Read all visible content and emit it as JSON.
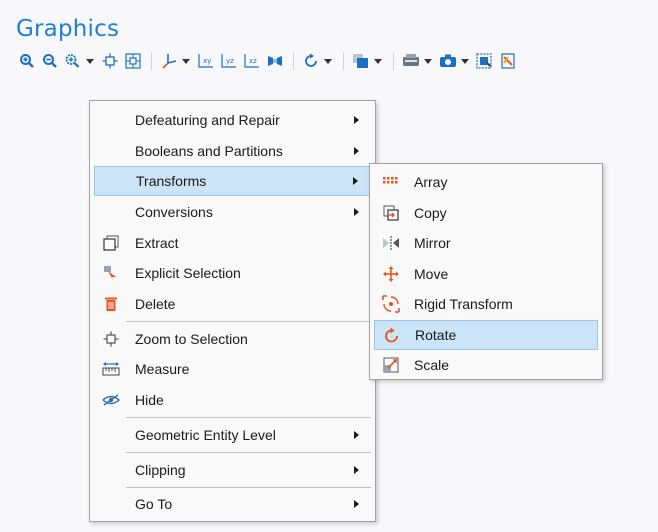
{
  "panel": {
    "title": "Graphics"
  },
  "toolbar": {
    "buttons": [
      {
        "icon": "zoom-in-icon"
      },
      {
        "icon": "zoom-out-icon"
      },
      {
        "icon": "zoom-box-icon"
      },
      {
        "icon": "zoom-selection-icon"
      },
      {
        "icon": "zoom-extents-icon"
      },
      {
        "icon": "axis-orientation-icon"
      },
      {
        "icon": "xy-view-icon"
      },
      {
        "icon": "yz-view-icon"
      },
      {
        "icon": "xz-view-icon"
      },
      {
        "icon": "perspective-icon"
      },
      {
        "icon": "rotate-view-icon"
      },
      {
        "icon": "transparency-icon"
      },
      {
        "icon": "render-icon"
      },
      {
        "icon": "screenshot-icon"
      },
      {
        "icon": "select-box-icon"
      },
      {
        "icon": "hide-icon"
      }
    ]
  },
  "context_menu": {
    "items": [
      {
        "label": "Defeaturing and Repair",
        "submenu": true
      },
      {
        "label": "Booleans and Partitions",
        "submenu": true
      },
      {
        "label": "Transforms",
        "submenu": true,
        "highlighted": true
      },
      {
        "label": "Conversions",
        "submenu": true
      },
      {
        "label": "Extract",
        "icon": "extract-icon"
      },
      {
        "label": "Explicit Selection",
        "icon": "explicit-selection-icon"
      },
      {
        "label": "Delete",
        "icon": "delete-icon"
      },
      {
        "label": "Zoom to Selection",
        "icon": "zoom-selection-icon"
      },
      {
        "label": "Measure",
        "icon": "measure-icon"
      },
      {
        "label": "Hide",
        "icon": "hide-icon"
      },
      {
        "label": "Geometric Entity Level",
        "submenu": true
      },
      {
        "label": "Clipping",
        "submenu": true
      },
      {
        "label": "Go To",
        "submenu": true
      }
    ]
  },
  "transforms_submenu": {
    "items": [
      {
        "label": "Array",
        "icon": "array-icon"
      },
      {
        "label": "Copy",
        "icon": "copy-icon"
      },
      {
        "label": "Mirror",
        "icon": "mirror-icon"
      },
      {
        "label": "Move",
        "icon": "move-icon"
      },
      {
        "label": "Rigid Transform",
        "icon": "rigid-transform-icon"
      },
      {
        "label": "Rotate",
        "icon": "rotate-icon",
        "highlighted": true
      },
      {
        "label": "Scale",
        "icon": "scale-icon"
      }
    ]
  },
  "colors": {
    "title": "#1f7fd0",
    "highlight": "#cce4f7",
    "icon_blue": "#1d6fc2",
    "icon_orange": "#e8531f"
  }
}
